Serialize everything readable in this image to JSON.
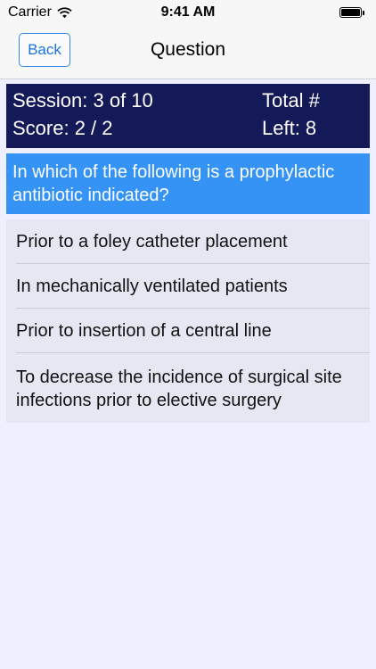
{
  "status_bar": {
    "carrier": "Carrier",
    "time": "9:41 AM",
    "wifi_icon": "wifi-icon",
    "battery_icon": "battery-icon",
    "battery_level": 1.0
  },
  "nav": {
    "back_label": "Back",
    "title": "Question"
  },
  "session": {
    "session_text": "Session: 3 of 10",
    "score_text": "Score: 2 / 2",
    "total_text": "Total #",
    "left_text": "Left: 8"
  },
  "question": {
    "text": "In which of the following is a prophylactic antibiotic indicated?"
  },
  "answers": [
    "Prior to a foley catheter placement",
    "In mechanically ventilated patients",
    "Prior to insertion of a central line",
    "To decrease the incidence of surgical site infections prior to elective surgery"
  ],
  "colors": {
    "session_panel_bg": "#141a58",
    "question_bg": "#3593f5",
    "answers_bg": "#e5e8f3",
    "page_bg": "#eef1fd",
    "accent": "#1b73e0"
  }
}
